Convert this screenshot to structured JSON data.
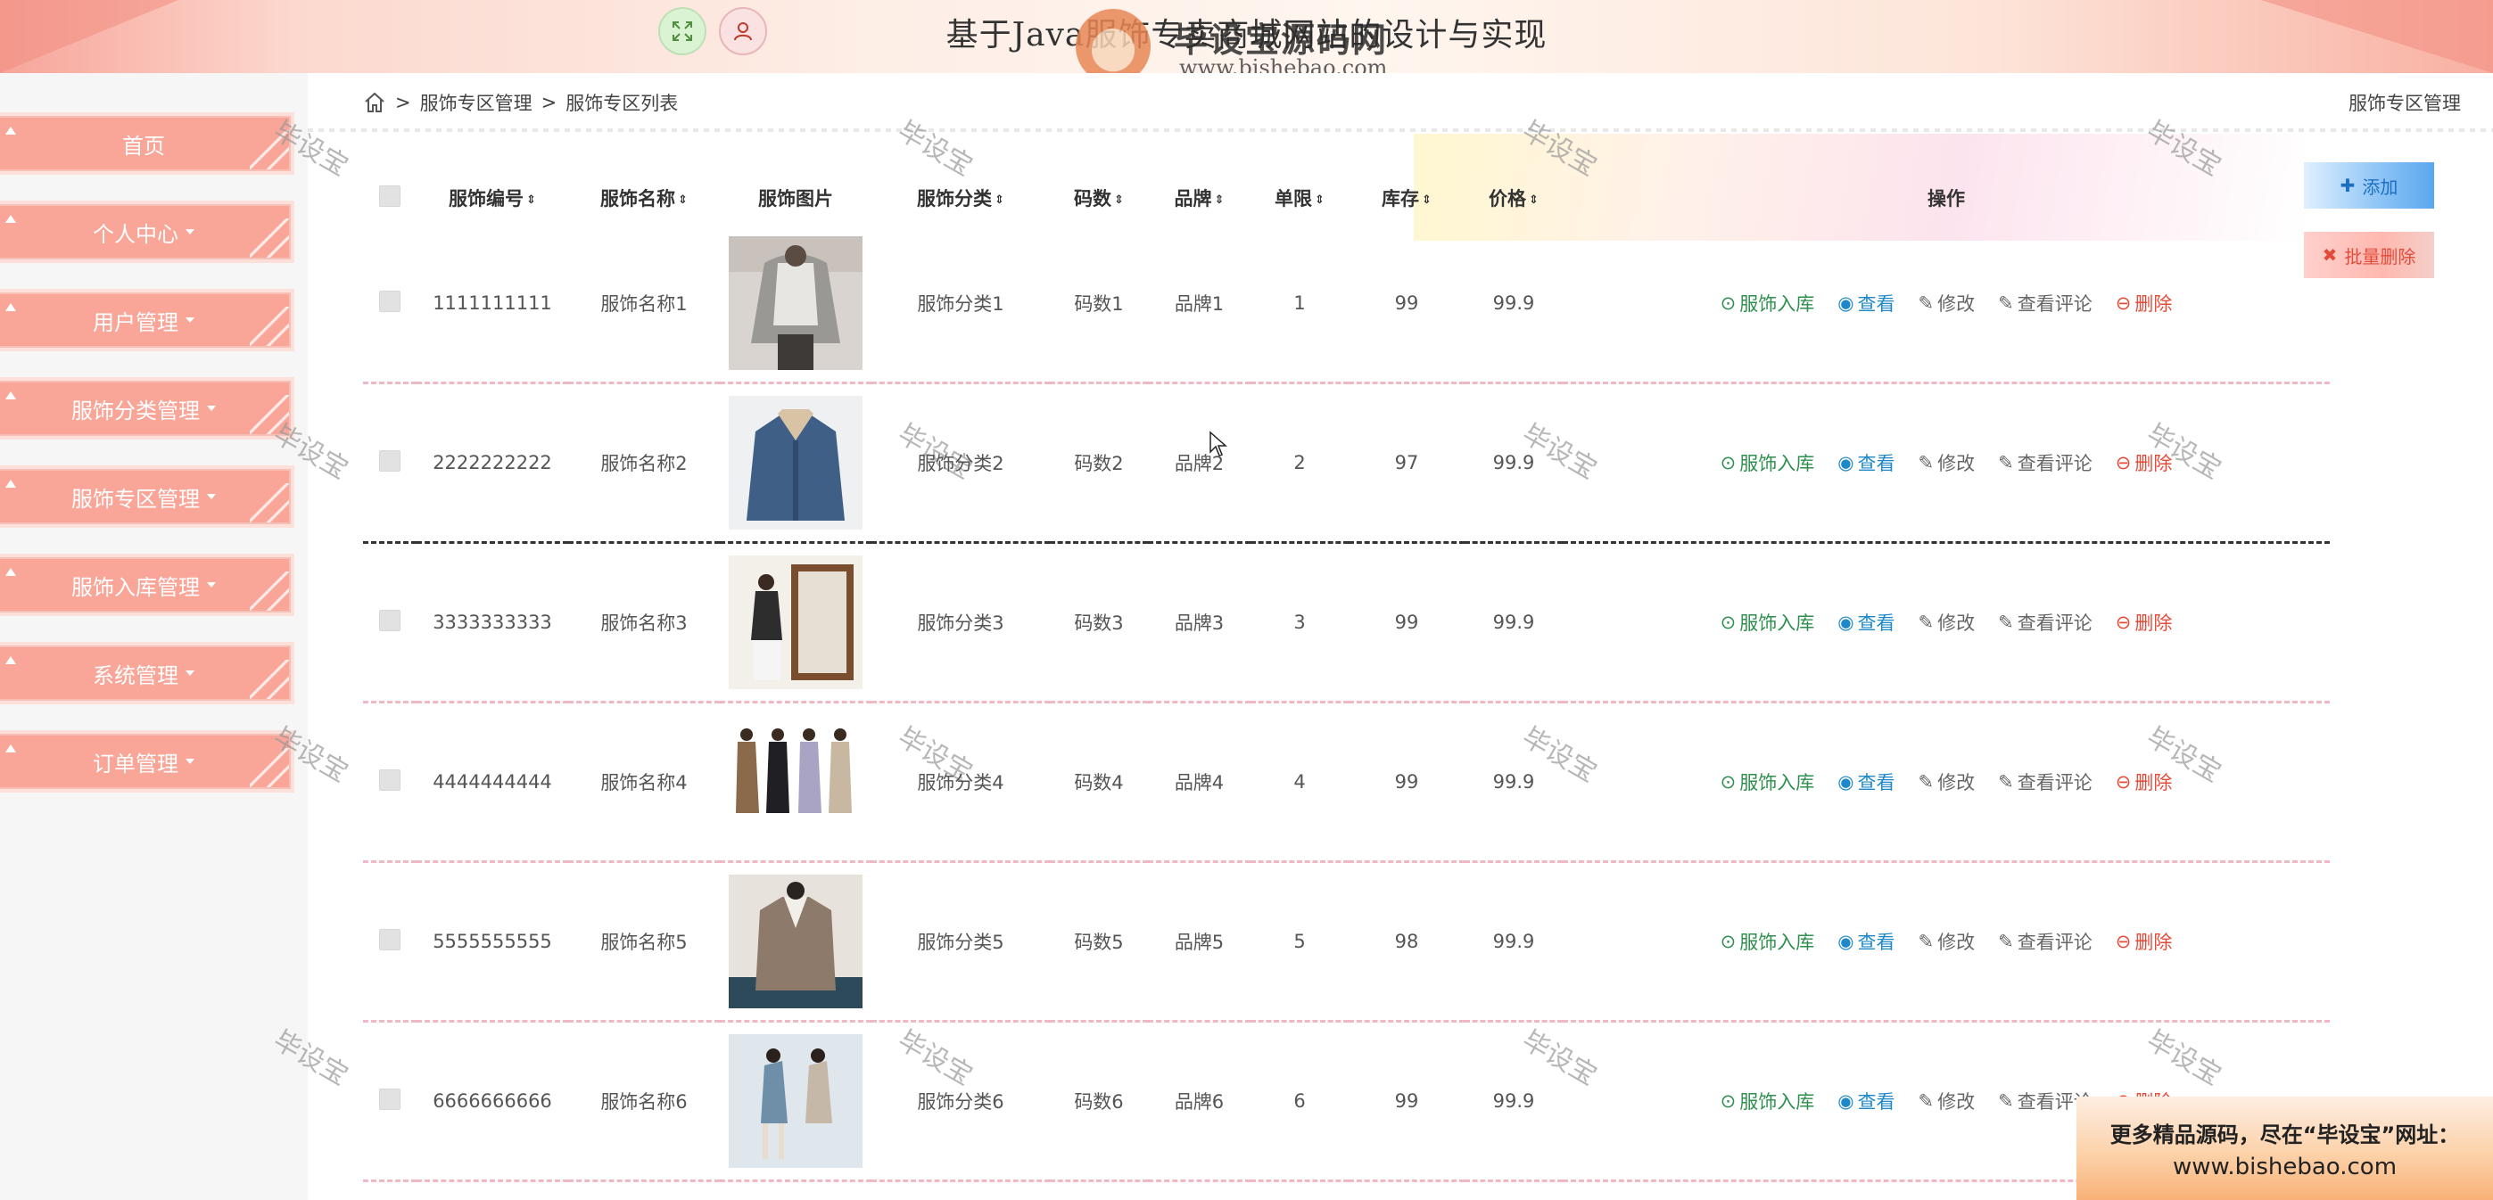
{
  "header": {
    "title": "基于Java服饰专卖商城网站的设计与实现",
    "watermark_brand": "毕设宝源码网",
    "watermark_url": "www.bishebao.com",
    "fullscreen_icon": "expand-icon",
    "user_icon": "user-icon"
  },
  "sidebar": {
    "items": [
      {
        "label": "首页",
        "has_caret": false
      },
      {
        "label": "个人中心",
        "has_caret": true
      },
      {
        "label": "用户管理",
        "has_caret": true
      },
      {
        "label": "服饰分类管理",
        "has_caret": true
      },
      {
        "label": "服饰专区管理",
        "has_caret": true
      },
      {
        "label": "服饰入库管理",
        "has_caret": true
      },
      {
        "label": "系统管理",
        "has_caret": true
      },
      {
        "label": "订单管理",
        "has_caret": true
      }
    ]
  },
  "breadcrumb": {
    "sep": ">",
    "level1": "服饰专区管理",
    "level2": "服饰专区列表",
    "right_label": "服饰专区管理"
  },
  "watermark_text": "毕设宝",
  "table": {
    "columns": [
      "服饰编号",
      "服饰名称",
      "服饰图片",
      "服饰分类",
      "码数",
      "品牌",
      "单限",
      "库存",
      "价格",
      "操作"
    ],
    "actions": {
      "inbound": "服饰入库",
      "view": "查看",
      "edit": "修改",
      "comments": "查看评论",
      "delete": "删除"
    },
    "rows": [
      {
        "id": "1111111111",
        "name": "服饰名称1",
        "category": "服饰分类1",
        "size": "码数1",
        "brand": "品牌1",
        "limit": "1",
        "stock": "99",
        "price": "99.9",
        "image": "grey-hoodie-photo"
      },
      {
        "id": "2222222222",
        "name": "服饰名称2",
        "category": "服饰分类2",
        "size": "码数2",
        "brand": "品牌2",
        "limit": "2",
        "stock": "97",
        "price": "99.9",
        "image": "denim-jacket-photo"
      },
      {
        "id": "3333333333",
        "name": "服饰名称3",
        "category": "服饰分类3",
        "size": "码数3",
        "brand": "品牌3",
        "limit": "3",
        "stock": "99",
        "price": "99.9",
        "image": "mirror-outfit-photo"
      },
      {
        "id": "4444444444",
        "name": "服饰名称4",
        "category": "服饰分类4",
        "size": "码数4",
        "brand": "品牌4",
        "limit": "4",
        "stock": "99",
        "price": "99.9",
        "image": "four-coats-photo"
      },
      {
        "id": "5555555555",
        "name": "服饰名称5",
        "category": "服饰分类5",
        "size": "码数5",
        "brand": "品牌5",
        "limit": "5",
        "stock": "98",
        "price": "99.9",
        "image": "beige-coat-photo"
      },
      {
        "id": "6666666666",
        "name": "服饰名称6",
        "category": "服饰分类6",
        "size": "码数6",
        "brand": "品牌6",
        "limit": "6",
        "stock": "99",
        "price": "99.9",
        "image": "denim-dress-photo"
      }
    ]
  },
  "buttons": {
    "add": "添加",
    "batch_delete": "批量删除"
  },
  "promo": {
    "line1": "更多精品源码，尽在“毕设宝”网址：",
    "line2": "www.bishebao.com"
  },
  "colors": {
    "sidebar_item": "#f9a699",
    "header_accent": "#f38c80",
    "inbound": "#2f8f4f",
    "view": "#1e88c8",
    "delete": "#e44c3a"
  }
}
